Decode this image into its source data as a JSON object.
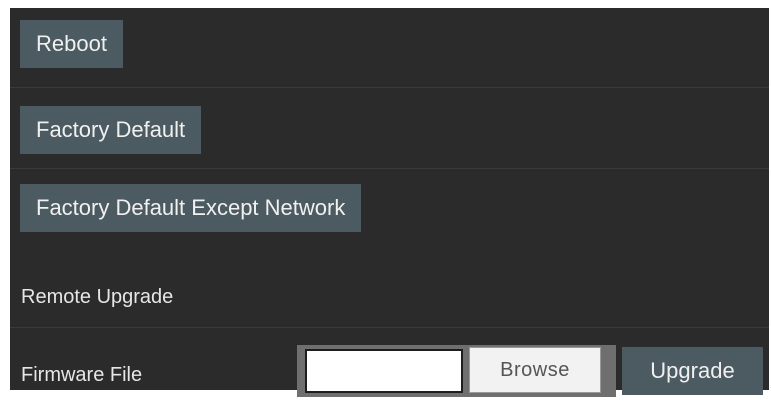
{
  "actions": {
    "reboot_label": "Reboot",
    "factory_default_label": "Factory Default",
    "factory_default_except_network_label": "Factory Default Except Network"
  },
  "upgrade": {
    "section_title": "Remote Upgrade",
    "firmware_file_label": "Firmware File",
    "file_input_value": "",
    "browse_label": "Browse",
    "upgrade_label": "Upgrade"
  },
  "colors": {
    "panel_background": "#2b2b2b",
    "button_background": "#4c5a62",
    "text": "#e6e6e6"
  }
}
